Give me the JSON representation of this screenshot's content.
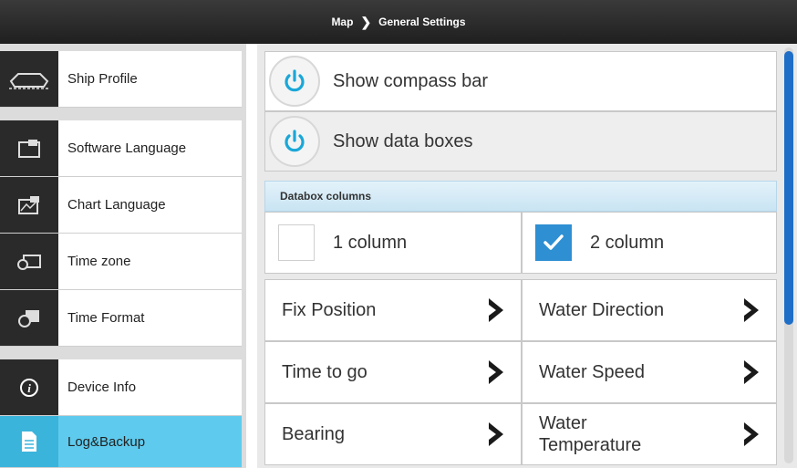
{
  "header": {
    "crumb_parent": "Map",
    "crumb_current": "General Settings"
  },
  "sidebar": {
    "items": [
      {
        "label": "Ship Profile",
        "icon": "ship-icon"
      },
      {
        "label": "Software Language",
        "icon": "language-icon"
      },
      {
        "label": "Chart Language",
        "icon": "chart-language-icon"
      },
      {
        "label": "Time zone",
        "icon": "time-zone-icon"
      },
      {
        "label": "Time Format",
        "icon": "time-format-icon"
      },
      {
        "label": "Device Info",
        "icon": "info-icon"
      },
      {
        "label": "Log&Backup",
        "icon": "document-icon",
        "active": true
      }
    ]
  },
  "toggles": [
    {
      "label": "Show compass bar"
    },
    {
      "label": "Show data boxes"
    }
  ],
  "databox": {
    "title": "Databox columns",
    "options": [
      {
        "label": "1 column",
        "checked": false
      },
      {
        "label": "2 column",
        "checked": true
      }
    ]
  },
  "fields": [
    {
      "label": "Fix Position"
    },
    {
      "label": "Water Direction"
    },
    {
      "label": "Time to go"
    },
    {
      "label": "Water Speed"
    },
    {
      "label": "Bearing"
    },
    {
      "label": "Water\nTemperature"
    }
  ],
  "colors": {
    "accent": "#5ecbee",
    "check": "#2e8fd3",
    "power": "#1aa7d8",
    "scroll": "#1e6ec8"
  }
}
